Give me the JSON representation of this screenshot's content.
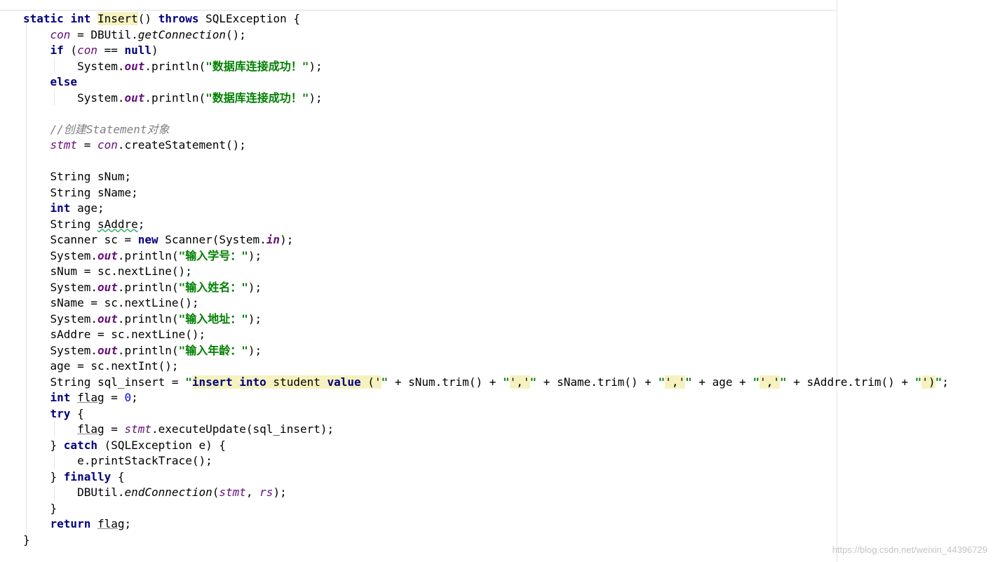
{
  "editor": {
    "lines": [
      [
        {
          "t": "static",
          "c": "kw"
        },
        {
          "t": " "
        },
        {
          "t": "int",
          "c": "kw"
        },
        {
          "t": " "
        },
        {
          "t": "Insert",
          "c": "hl"
        },
        {
          "t": "() "
        },
        {
          "t": "throws",
          "c": "kw"
        },
        {
          "t": " SQLException {"
        }
      ],
      [
        {
          "t": "    "
        },
        {
          "t": "con",
          "c": "field"
        },
        {
          "t": " = DBUtil."
        },
        {
          "t": "getConnection",
          "c": "static"
        },
        {
          "t": "();"
        }
      ],
      [
        {
          "t": "    "
        },
        {
          "t": "if",
          "c": "kw"
        },
        {
          "t": " ("
        },
        {
          "t": "con",
          "c": "field"
        },
        {
          "t": " == "
        },
        {
          "t": "null",
          "c": "kw"
        },
        {
          "t": ")"
        }
      ],
      [
        {
          "t": "        System."
        },
        {
          "t": "out",
          "c": "fieldb"
        },
        {
          "t": ".println("
        },
        {
          "t": "\"数据库连接成功！\"",
          "c": "str"
        },
        {
          "t": ");"
        }
      ],
      [
        {
          "t": "    "
        },
        {
          "t": "else",
          "c": "kw"
        }
      ],
      [
        {
          "t": "        System."
        },
        {
          "t": "out",
          "c": "fieldb"
        },
        {
          "t": ".println("
        },
        {
          "t": "\"数据库连接成功！\"",
          "c": "str"
        },
        {
          "t": ");"
        }
      ],
      [
        {
          "t": ""
        }
      ],
      [
        {
          "t": "    "
        },
        {
          "t": "//创建Statement对象",
          "c": "cmt"
        }
      ],
      [
        {
          "t": "    "
        },
        {
          "t": "stmt",
          "c": "field"
        },
        {
          "t": " = "
        },
        {
          "t": "con",
          "c": "field"
        },
        {
          "t": ".createStatement();"
        }
      ],
      [
        {
          "t": ""
        }
      ],
      [
        {
          "t": "    String sNum;"
        }
      ],
      [
        {
          "t": "    String sName;"
        }
      ],
      [
        {
          "t": "    "
        },
        {
          "t": "int",
          "c": "kw"
        },
        {
          "t": " age;"
        }
      ],
      [
        {
          "t": "    String "
        },
        {
          "t": "sAddre",
          "c": "wavy"
        },
        {
          "t": ";"
        }
      ],
      [
        {
          "t": "    Scanner sc = "
        },
        {
          "t": "new",
          "c": "kw"
        },
        {
          "t": " Scanner(System."
        },
        {
          "t": "in",
          "c": "fieldb"
        },
        {
          "t": ");"
        }
      ],
      [
        {
          "t": "    System."
        },
        {
          "t": "out",
          "c": "fieldb"
        },
        {
          "t": ".println("
        },
        {
          "t": "\"输入学号：\"",
          "c": "str"
        },
        {
          "t": ");"
        }
      ],
      [
        {
          "t": "    sNum = sc.nextLine();"
        }
      ],
      [
        {
          "t": "    System."
        },
        {
          "t": "out",
          "c": "fieldb"
        },
        {
          "t": ".println("
        },
        {
          "t": "\"输入姓名：\"",
          "c": "str"
        },
        {
          "t": ");"
        }
      ],
      [
        {
          "t": "    sName = sc.nextLine();"
        }
      ],
      [
        {
          "t": "    System."
        },
        {
          "t": "out",
          "c": "fieldb"
        },
        {
          "t": ".println("
        },
        {
          "t": "\"输入地址：\"",
          "c": "str"
        },
        {
          "t": ");"
        }
      ],
      [
        {
          "t": "    sAddre = sc.nextLine();"
        }
      ],
      [
        {
          "t": "    System."
        },
        {
          "t": "out",
          "c": "fieldb"
        },
        {
          "t": ".println("
        },
        {
          "t": "\"输入年龄：\"",
          "c": "str"
        },
        {
          "t": ");"
        }
      ],
      [
        {
          "t": "    age = sc.nextInt();"
        }
      ],
      [
        {
          "t": "    String sql_insert = "
        },
        {
          "t": "\"",
          "c": "str"
        },
        {
          "t": "insert",
          "c": "kw hl"
        },
        {
          "t": " ",
          "c": "hl"
        },
        {
          "t": "into",
          "c": "kw hl"
        },
        {
          "t": " student ",
          "c": "hl"
        },
        {
          "t": "value",
          "c": "kw hl"
        },
        {
          "t": " ('",
          "c": "hl"
        },
        {
          "t": "\"",
          "c": "str"
        },
        {
          "t": " + sNum.trim() + "
        },
        {
          "t": "\"",
          "c": "str"
        },
        {
          "t": "','",
          "c": "hl"
        },
        {
          "t": "\"",
          "c": "str"
        },
        {
          "t": " + sName.trim() + "
        },
        {
          "t": "\"",
          "c": "str"
        },
        {
          "t": "','",
          "c": "hl"
        },
        {
          "t": "\"",
          "c": "str"
        },
        {
          "t": " + age + "
        },
        {
          "t": "\"",
          "c": "str"
        },
        {
          "t": "','",
          "c": "hl"
        },
        {
          "t": "\"",
          "c": "str"
        },
        {
          "t": " + sAddre.trim() + "
        },
        {
          "t": "\"",
          "c": "str"
        },
        {
          "t": "')",
          "c": "hl"
        },
        {
          "t": "\"",
          "c": "str"
        },
        {
          "t": ";"
        }
      ],
      [
        {
          "t": "    "
        },
        {
          "t": "int",
          "c": "kw"
        },
        {
          "t": " "
        },
        {
          "t": "flag",
          "c": "uline"
        },
        {
          "t": " = "
        },
        {
          "t": "0",
          "c": "num"
        },
        {
          "t": ";"
        }
      ],
      [
        {
          "t": "    "
        },
        {
          "t": "try",
          "c": "kw"
        },
        {
          "t": " {"
        }
      ],
      [
        {
          "t": "        "
        },
        {
          "t": "flag",
          "c": "uline"
        },
        {
          "t": " = "
        },
        {
          "t": "stmt",
          "c": "field"
        },
        {
          "t": ".executeUpdate(sql_insert);"
        }
      ],
      [
        {
          "t": "    } "
        },
        {
          "t": "catch",
          "c": "kw"
        },
        {
          "t": " (SQLException e) {"
        }
      ],
      [
        {
          "t": "        e.printStackTrace();"
        }
      ],
      [
        {
          "t": "    } "
        },
        {
          "t": "finally",
          "c": "kw"
        },
        {
          "t": " {"
        }
      ],
      [
        {
          "t": "        DBUtil."
        },
        {
          "t": "endConnection",
          "c": "static"
        },
        {
          "t": "("
        },
        {
          "t": "stmt",
          "c": "field"
        },
        {
          "t": ", "
        },
        {
          "t": "rs",
          "c": "field"
        },
        {
          "t": ");"
        }
      ],
      [
        {
          "t": "    }"
        }
      ],
      [
        {
          "t": "    "
        },
        {
          "t": "return",
          "c": "kw"
        },
        {
          "t": " "
        },
        {
          "t": "flag",
          "c": "uline"
        },
        {
          "t": ";"
        }
      ],
      [
        {
          "t": "}"
        }
      ]
    ]
  },
  "watermark": "https://blog.csdn.net/weixin_44396729",
  "colors": {
    "keyword": "#000080",
    "string": "#008000",
    "number": "#0000ff",
    "comment": "#808080",
    "field": "#660e7a",
    "highlight": "#f6f2bf"
  }
}
